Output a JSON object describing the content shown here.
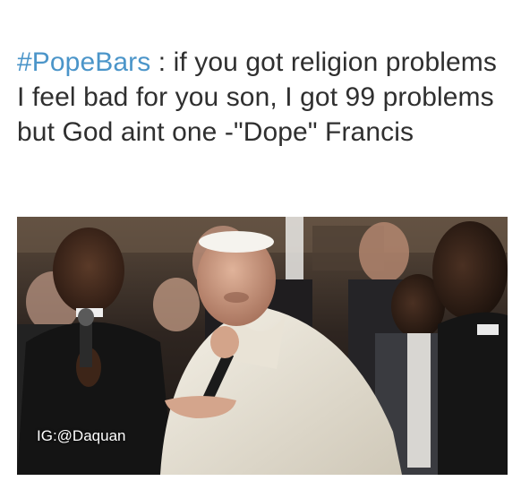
{
  "post": {
    "hashtag": "#PopeBars",
    "text": " : if you got religion problems I feel bad for you son, I got 99 problems but God aint one -\"Dope\" Francis"
  },
  "photo": {
    "watermark": "IG:@Daquan"
  }
}
